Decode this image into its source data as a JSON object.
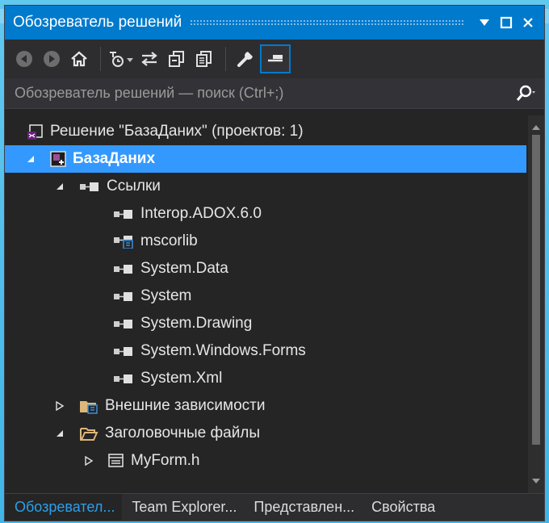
{
  "window": {
    "title": "Обозреватель решений"
  },
  "toolbar": {
    "icons": [
      "back-icon",
      "forward-icon",
      "home-icon",
      "pending-changes-filter-icon",
      "sync-with-active-document-icon",
      "collapse-all-icon",
      "show-all-files-icon",
      "properties-wrench-icon",
      "preview-selected-items-icon"
    ]
  },
  "search": {
    "placeholder": "Обозреватель решений — поиск (Ctrl+;)"
  },
  "tree": {
    "solution": "Решение \"БазаДаних\"  (проектов: 1)",
    "project": "БазаДаних",
    "references": "Ссылки",
    "refs": [
      "Interop.ADOX.6.0",
      "mscorlib",
      "System.Data",
      "System",
      "System.Drawing",
      "System.Windows.Forms",
      "System.Xml"
    ],
    "external_deps": "Внешние зависимости",
    "header_files": "Заголовочные файлы",
    "file": "MyForm.h"
  },
  "tabs": [
    "Обозревател...",
    "Team Explorer...",
    "Представлен...",
    "Свойства"
  ],
  "colors": {
    "accent": "#007acc",
    "selection": "#3399ff",
    "panel": "#252526",
    "page": "#40b5e8"
  }
}
